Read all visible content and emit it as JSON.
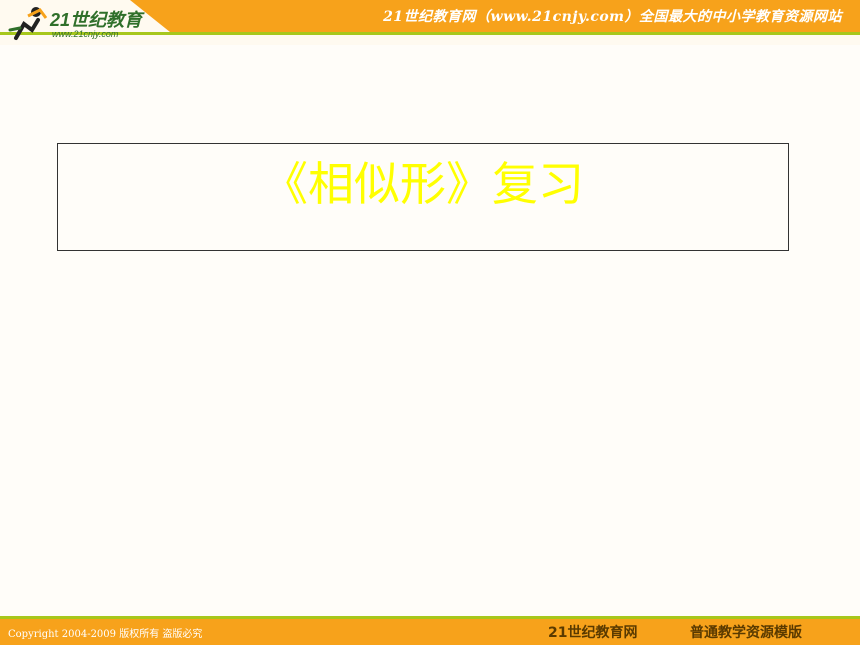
{
  "header": {
    "logo_main": "21世纪教育",
    "logo_url": "www.21cnjy.com",
    "tagline": "21世纪教育网（www.21cnjy.com）全国最大的中小学教育资源网站"
  },
  "slide": {
    "title": "《相似形》复习"
  },
  "footer": {
    "copyright": "Copyright 2004-2009 版权所有 盗版必究",
    "brand": "21世纪教育网",
    "template": "普通教学资源模版"
  },
  "colors": {
    "header_bar": "#f7a21b",
    "accent_line": "#a7c71c",
    "title_text": "#ffff00"
  }
}
